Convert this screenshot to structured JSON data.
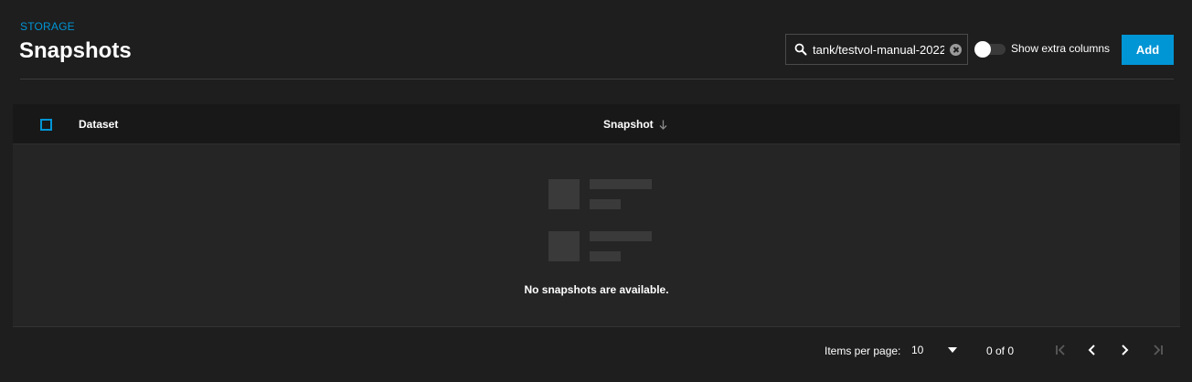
{
  "header": {
    "breadcrumb": "STORAGE",
    "title": "Snapshots"
  },
  "toolbar": {
    "search_value": "tank/testvol-manual-2022",
    "extra_columns_label": "Show extra columns",
    "extra_columns_on": false,
    "add_label": "Add"
  },
  "table": {
    "columns": [
      "Dataset",
      "Snapshot"
    ],
    "sort_column": "Snapshot",
    "sort_direction": "descending",
    "empty_message": "No snapshots are available."
  },
  "pagination": {
    "items_per_page_label": "Items per page:",
    "items_per_page": "10",
    "range_label": "0 of 0"
  },
  "colors": {
    "accent": "#0095d5",
    "background": "#1e1e1e",
    "table_body": "#252525"
  }
}
